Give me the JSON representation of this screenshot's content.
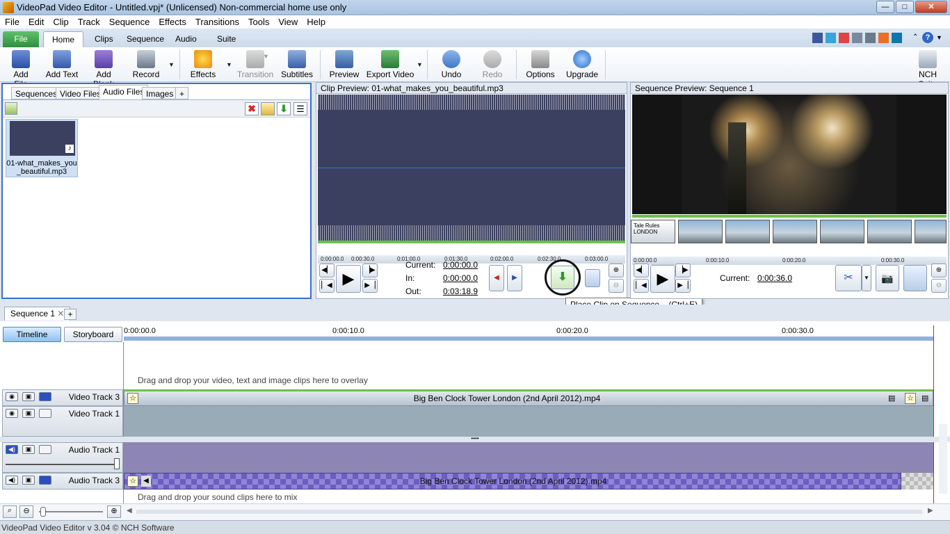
{
  "window": {
    "title": "VideoPad Video Editor - Untitled.vpj* (Unlicensed) Non-commercial home use only",
    "min": "—",
    "max": "□",
    "close": "✕"
  },
  "menu": [
    "File",
    "Edit",
    "Clip",
    "Track",
    "Sequence",
    "Effects",
    "Transitions",
    "Tools",
    "View",
    "Help"
  ],
  "ribbon_tabs": [
    "File",
    "Home",
    "Clips",
    "Sequence",
    "Audio",
    "Suite"
  ],
  "toolbar": {
    "add_file": "Add File",
    "add_text": "Add Text",
    "add_blank": "Add Blank",
    "record": "Record",
    "effects": "Effects",
    "transition": "Transition",
    "subtitles": "Subtitles",
    "preview": "Preview",
    "export_video": "Export Video",
    "undo": "Undo",
    "redo": "Redo",
    "options": "Options",
    "upgrade": "Upgrade",
    "nch_suite": "NCH Suite"
  },
  "bin_tabs": [
    "Sequences",
    "Video Files",
    "Audio Files",
    "Images",
    "+"
  ],
  "bin_item": {
    "name": "01-what_makes_you_beautiful.mp3"
  },
  "clip_preview": {
    "header": "Clip Preview: 01-what_makes_you_beautiful.mp3",
    "ruler": [
      "0:00:00.0",
      "0:00:30.0",
      "0:01:00.0",
      "0:01:30.0",
      "0:02:00.0",
      "0:02:30.0",
      "0:03:00.0"
    ],
    "current_label": "Current:",
    "current": "0:00:00.0",
    "in_label": "In:",
    "in": "0:00:00.0",
    "out_label": "Out:",
    "out": "0:03:18.9",
    "tooltip": "Place Clip on Sequence... (Ctrl+E)"
  },
  "sequence_preview": {
    "header": "Sequence Preview: Sequence 1",
    "ruler": [
      "0:00:00.0",
      "0:00:10.0",
      "0:00:20.0",
      "0:00:30.0"
    ],
    "current_label": "Current:",
    "current": "0:00:36.0",
    "thumb1_text": "Tale Rules LONDON"
  },
  "sequence_tab": "Sequence 1",
  "view_buttons": {
    "timeline": "Timeline",
    "storyboard": "Storyboard"
  },
  "timeline_ruler": [
    "0:00:00.0",
    "0:00:10.0",
    "0:00:20.0",
    "0:00:30.0"
  ],
  "tracks": {
    "overlay_hint": "Drag and drop your video, text and image clips here to overlay",
    "video3": "Video Track 3",
    "video1": "Video Track 1",
    "video_clip": "Big Ben Clock Tower London (2nd April 2012).mp4",
    "audio1": "Audio Track 1",
    "audio3": "Audio Track 3",
    "audio_clip": "Big Ben Clock Tower London (2nd April 2012).mp4",
    "audio_hint": "Drag and drop your sound clips here to mix"
  },
  "status": "VideoPad Video Editor v 3.04 © NCH Software",
  "colors": {
    "accent": "#3a6fd8",
    "waveform": "#3b4060",
    "track_video": "#b6c2cf",
    "track_audio": "#8d85b3"
  }
}
